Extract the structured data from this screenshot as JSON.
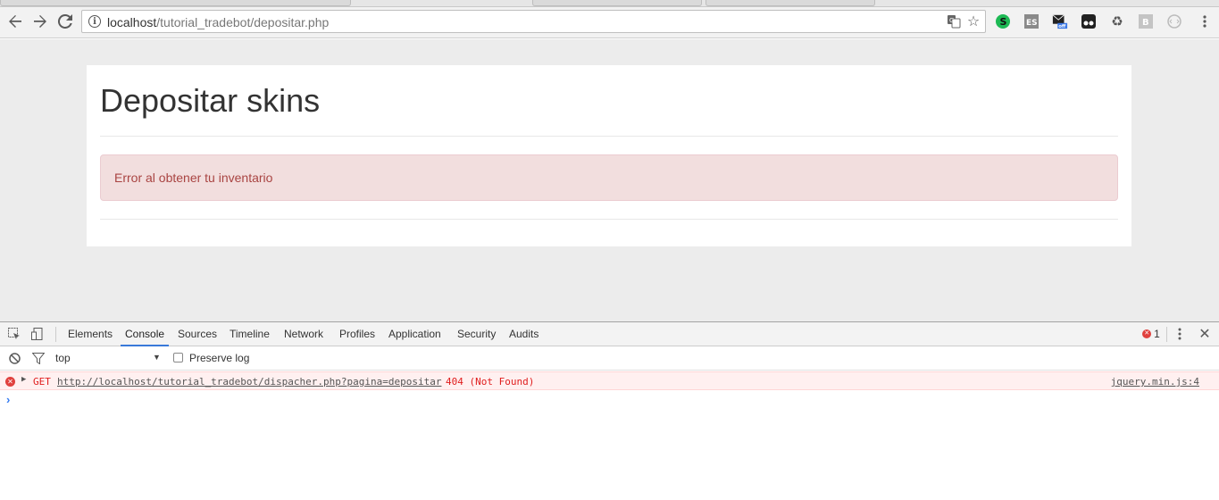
{
  "browser": {
    "url_host": "localhost",
    "url_path": "/tutorial_tradebot/depositar.php",
    "icons": [
      "back-icon",
      "forward-icon",
      "reload-icon",
      "info-icon",
      "translate-icon",
      "star-icon"
    ],
    "extensions": [
      {
        "name": "s-extension-icon",
        "text": "S",
        "color": "#1db954"
      },
      {
        "name": "es-extension-icon",
        "text": "ES",
        "color": "#888888"
      },
      {
        "name": "mail-off-extension-icon",
        "text": "off",
        "color": "#3b78e7"
      },
      {
        "name": "tampermonkey-extension-icon",
        "text": "",
        "color": "#222222"
      },
      {
        "name": "recycle-extension-icon",
        "text": "♻",
        "color": "#555555"
      },
      {
        "name": "b-extension-icon",
        "text": "B",
        "color": "#bbbbbb"
      },
      {
        "name": "circle-extension-icon",
        "text": "",
        "color": "#bbbbbb"
      }
    ]
  },
  "page": {
    "title": "Depositar skins",
    "alert": "Error al obtener tu inventario",
    "alert_color": "#a94442"
  },
  "devtools": {
    "tabs": [
      "Elements",
      "Console",
      "Sources",
      "Timeline",
      "Network",
      "Profiles",
      "Application",
      "Security",
      "Audits"
    ],
    "active_tab": "Console",
    "error_count": "1",
    "context": "top",
    "preserve_log_label": "Preserve log",
    "console": {
      "error": {
        "method": "GET",
        "url": "http://localhost/tutorial_tradebot/dispacher.php?pagina=depositar",
        "status": "404 (Not Found)",
        "source": "jquery.min.js:4"
      },
      "prompt": "›"
    }
  }
}
